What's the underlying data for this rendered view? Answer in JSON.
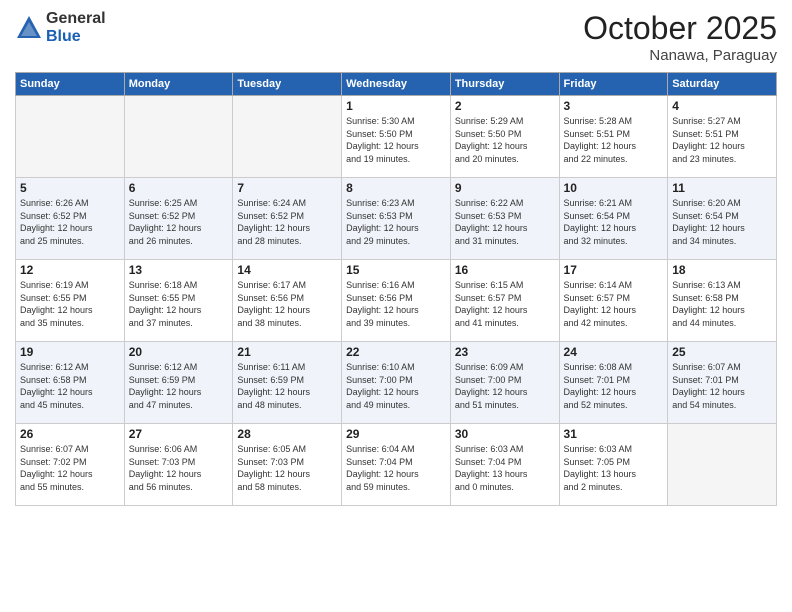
{
  "logo": {
    "general": "General",
    "blue": "Blue"
  },
  "header": {
    "month": "October 2025",
    "location": "Nanawa, Paraguay"
  },
  "weekdays": [
    "Sunday",
    "Monday",
    "Tuesday",
    "Wednesday",
    "Thursday",
    "Friday",
    "Saturday"
  ],
  "weeks": [
    [
      {
        "day": "",
        "info": ""
      },
      {
        "day": "",
        "info": ""
      },
      {
        "day": "",
        "info": ""
      },
      {
        "day": "1",
        "info": "Sunrise: 5:30 AM\nSunset: 5:50 PM\nDaylight: 12 hours\nand 19 minutes."
      },
      {
        "day": "2",
        "info": "Sunrise: 5:29 AM\nSunset: 5:50 PM\nDaylight: 12 hours\nand 20 minutes."
      },
      {
        "day": "3",
        "info": "Sunrise: 5:28 AM\nSunset: 5:51 PM\nDaylight: 12 hours\nand 22 minutes."
      },
      {
        "day": "4",
        "info": "Sunrise: 5:27 AM\nSunset: 5:51 PM\nDaylight: 12 hours\nand 23 minutes."
      }
    ],
    [
      {
        "day": "5",
        "info": "Sunrise: 6:26 AM\nSunset: 6:52 PM\nDaylight: 12 hours\nand 25 minutes."
      },
      {
        "day": "6",
        "info": "Sunrise: 6:25 AM\nSunset: 6:52 PM\nDaylight: 12 hours\nand 26 minutes."
      },
      {
        "day": "7",
        "info": "Sunrise: 6:24 AM\nSunset: 6:52 PM\nDaylight: 12 hours\nand 28 minutes."
      },
      {
        "day": "8",
        "info": "Sunrise: 6:23 AM\nSunset: 6:53 PM\nDaylight: 12 hours\nand 29 minutes."
      },
      {
        "day": "9",
        "info": "Sunrise: 6:22 AM\nSunset: 6:53 PM\nDaylight: 12 hours\nand 31 minutes."
      },
      {
        "day": "10",
        "info": "Sunrise: 6:21 AM\nSunset: 6:54 PM\nDaylight: 12 hours\nand 32 minutes."
      },
      {
        "day": "11",
        "info": "Sunrise: 6:20 AM\nSunset: 6:54 PM\nDaylight: 12 hours\nand 34 minutes."
      }
    ],
    [
      {
        "day": "12",
        "info": "Sunrise: 6:19 AM\nSunset: 6:55 PM\nDaylight: 12 hours\nand 35 minutes."
      },
      {
        "day": "13",
        "info": "Sunrise: 6:18 AM\nSunset: 6:55 PM\nDaylight: 12 hours\nand 37 minutes."
      },
      {
        "day": "14",
        "info": "Sunrise: 6:17 AM\nSunset: 6:56 PM\nDaylight: 12 hours\nand 38 minutes."
      },
      {
        "day": "15",
        "info": "Sunrise: 6:16 AM\nSunset: 6:56 PM\nDaylight: 12 hours\nand 39 minutes."
      },
      {
        "day": "16",
        "info": "Sunrise: 6:15 AM\nSunset: 6:57 PM\nDaylight: 12 hours\nand 41 minutes."
      },
      {
        "day": "17",
        "info": "Sunrise: 6:14 AM\nSunset: 6:57 PM\nDaylight: 12 hours\nand 42 minutes."
      },
      {
        "day": "18",
        "info": "Sunrise: 6:13 AM\nSunset: 6:58 PM\nDaylight: 12 hours\nand 44 minutes."
      }
    ],
    [
      {
        "day": "19",
        "info": "Sunrise: 6:12 AM\nSunset: 6:58 PM\nDaylight: 12 hours\nand 45 minutes."
      },
      {
        "day": "20",
        "info": "Sunrise: 6:12 AM\nSunset: 6:59 PM\nDaylight: 12 hours\nand 47 minutes."
      },
      {
        "day": "21",
        "info": "Sunrise: 6:11 AM\nSunset: 6:59 PM\nDaylight: 12 hours\nand 48 minutes."
      },
      {
        "day": "22",
        "info": "Sunrise: 6:10 AM\nSunset: 7:00 PM\nDaylight: 12 hours\nand 49 minutes."
      },
      {
        "day": "23",
        "info": "Sunrise: 6:09 AM\nSunset: 7:00 PM\nDaylight: 12 hours\nand 51 minutes."
      },
      {
        "day": "24",
        "info": "Sunrise: 6:08 AM\nSunset: 7:01 PM\nDaylight: 12 hours\nand 52 minutes."
      },
      {
        "day": "25",
        "info": "Sunrise: 6:07 AM\nSunset: 7:01 PM\nDaylight: 12 hours\nand 54 minutes."
      }
    ],
    [
      {
        "day": "26",
        "info": "Sunrise: 6:07 AM\nSunset: 7:02 PM\nDaylight: 12 hours\nand 55 minutes."
      },
      {
        "day": "27",
        "info": "Sunrise: 6:06 AM\nSunset: 7:03 PM\nDaylight: 12 hours\nand 56 minutes."
      },
      {
        "day": "28",
        "info": "Sunrise: 6:05 AM\nSunset: 7:03 PM\nDaylight: 12 hours\nand 58 minutes."
      },
      {
        "day": "29",
        "info": "Sunrise: 6:04 AM\nSunset: 7:04 PM\nDaylight: 12 hours\nand 59 minutes."
      },
      {
        "day": "30",
        "info": "Sunrise: 6:03 AM\nSunset: 7:04 PM\nDaylight: 13 hours\nand 0 minutes."
      },
      {
        "day": "31",
        "info": "Sunrise: 6:03 AM\nSunset: 7:05 PM\nDaylight: 13 hours\nand 2 minutes."
      },
      {
        "day": "",
        "info": ""
      }
    ]
  ]
}
